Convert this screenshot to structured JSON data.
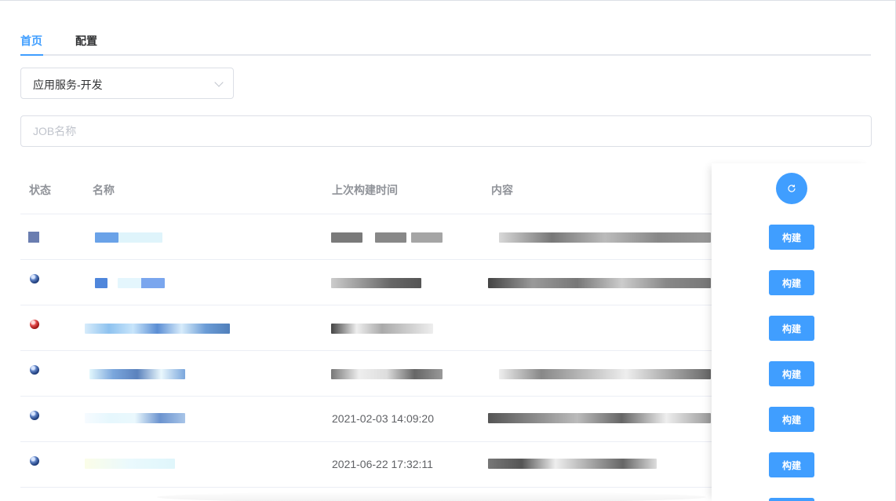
{
  "tabs": [
    {
      "label": "首页",
      "active": true
    },
    {
      "label": "配置",
      "active": false
    }
  ],
  "select": {
    "value": "应用服务-开发"
  },
  "search": {
    "placeholder": "JOB名称",
    "value": ""
  },
  "table": {
    "headers": {
      "status": "状态",
      "name": "名称",
      "last_build_time": "上次构建时间",
      "content": "内容"
    },
    "rows": [
      {
        "status": "square",
        "last_build_time": "",
        "build_label": "构建"
      },
      {
        "status": "blue",
        "last_build_time": "",
        "build_label": "构建"
      },
      {
        "status": "red",
        "last_build_time": "",
        "build_label": "构建"
      },
      {
        "status": "blue",
        "last_build_time": "",
        "build_label": "构建"
      },
      {
        "status": "blue",
        "last_build_time": "2021-02-03 14:09:20",
        "build_label": "构建"
      },
      {
        "status": "blue",
        "last_build_time": "2021-06-22 17:32:11",
        "build_label": "构建"
      }
    ],
    "refresh_icon": "refresh-icon"
  },
  "colors": {
    "accent": "#409eff",
    "border": "#dcdfe6",
    "status_blue": "#3e5fa3",
    "status_red": "#d93030"
  }
}
